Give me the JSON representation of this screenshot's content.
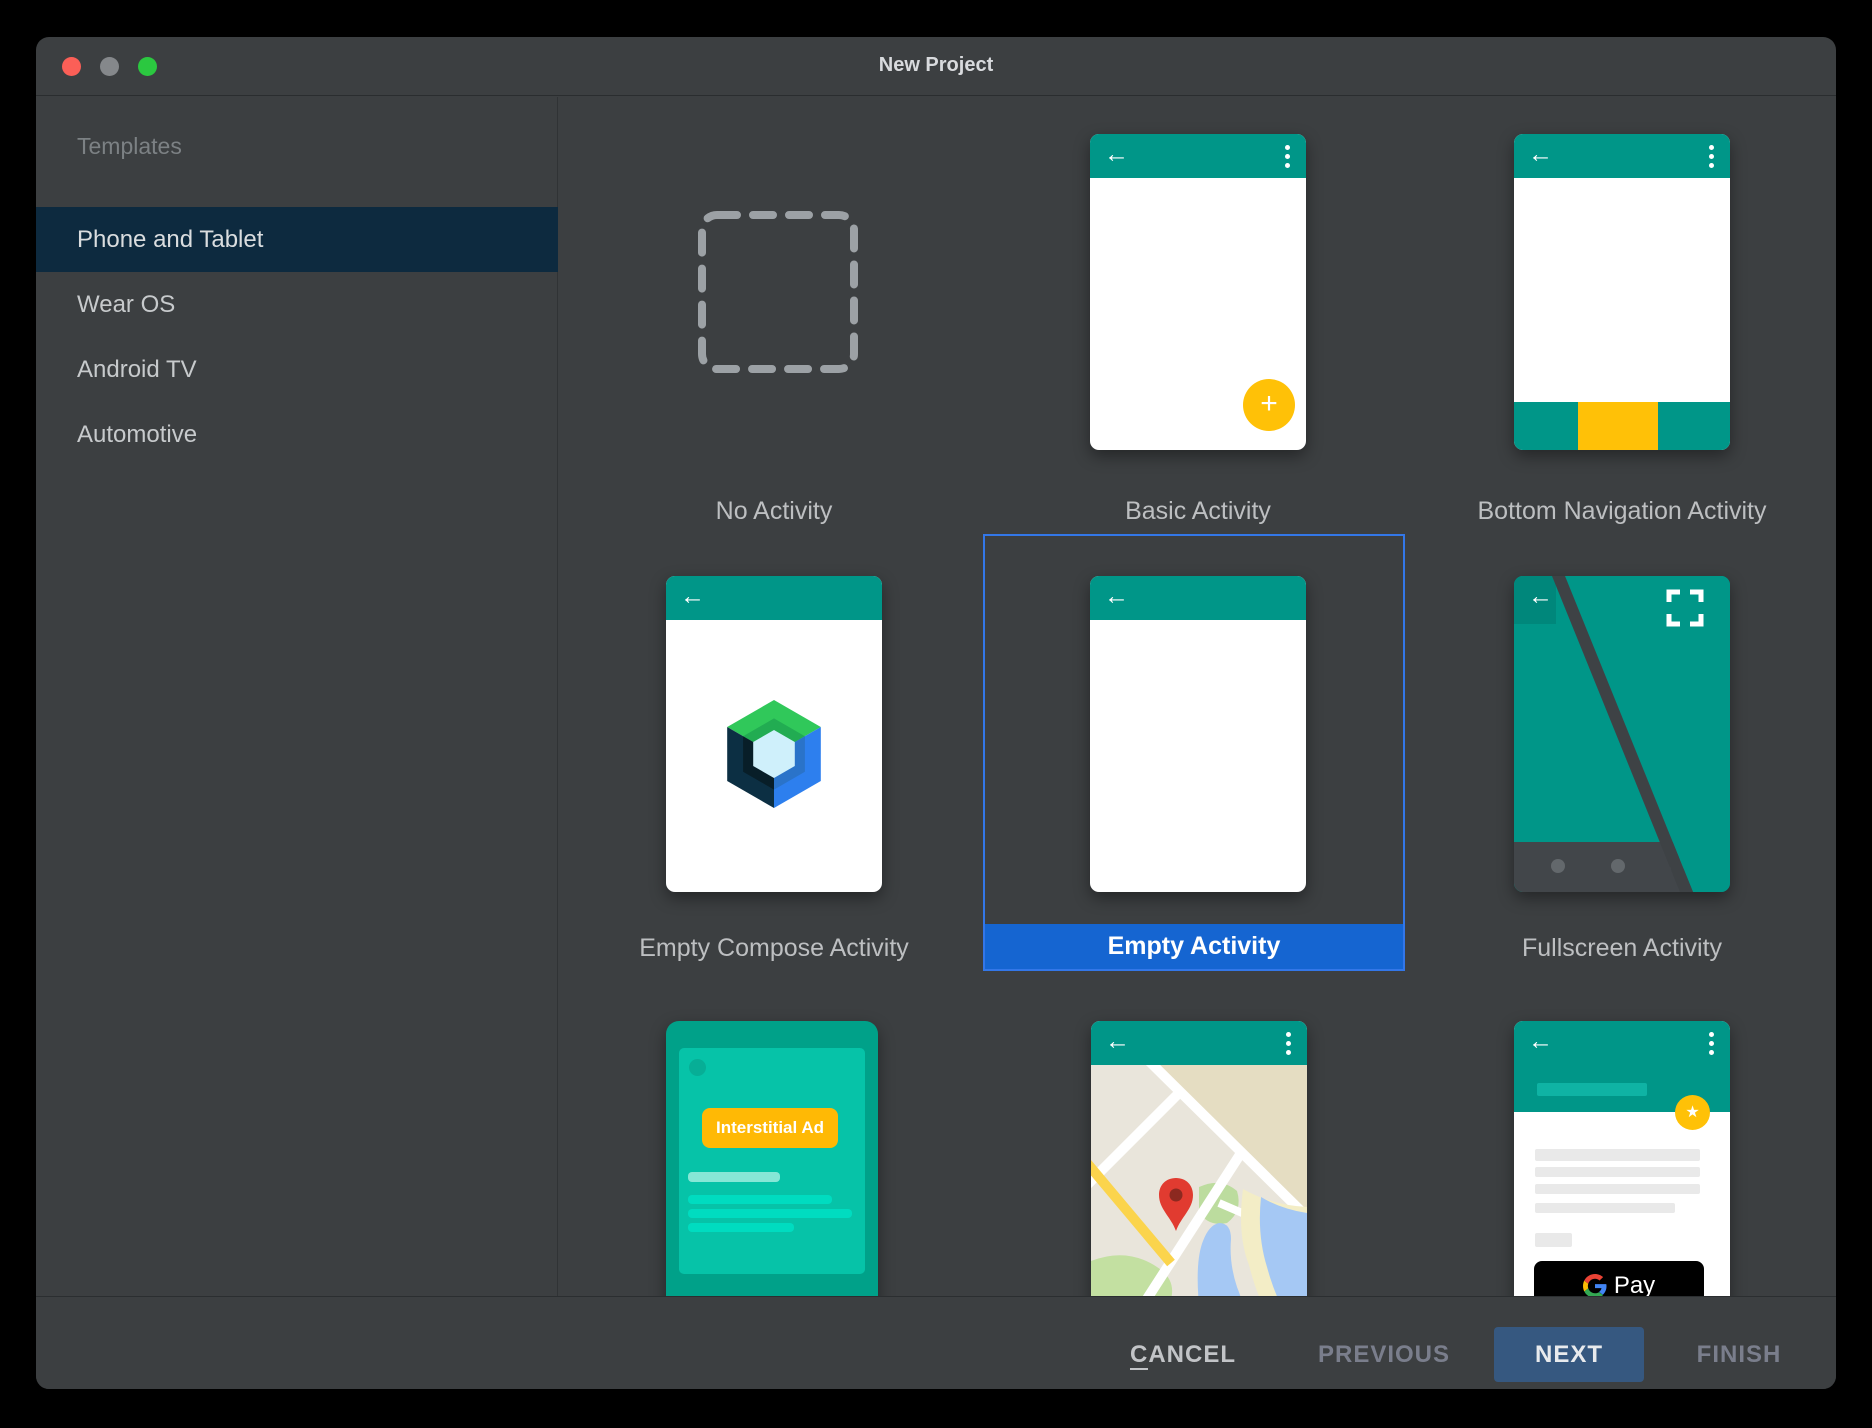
{
  "window": {
    "title": "New Project"
  },
  "sidebar": {
    "header": "Templates",
    "items": [
      {
        "label": "Phone and Tablet",
        "selected": true
      },
      {
        "label": "Wear OS",
        "selected": false
      },
      {
        "label": "Android TV",
        "selected": false
      },
      {
        "label": "Automotive",
        "selected": false
      }
    ]
  },
  "grid": {
    "tiles": [
      {
        "label": "No Activity",
        "selected": false
      },
      {
        "label": "Basic Activity",
        "selected": false
      },
      {
        "label": "Bottom Navigation Activity",
        "selected": false
      },
      {
        "label": "Empty Compose Activity",
        "selected": false
      },
      {
        "label": "Empty Activity",
        "selected": true
      },
      {
        "label": "Fullscreen Activity",
        "selected": false
      }
    ],
    "ad_card": {
      "chip": "Interstitial Ad"
    },
    "gpay_card": {
      "g": "G",
      "pay_label": "Pay"
    }
  },
  "footer": {
    "cancel_initial": "C",
    "cancel_rest": "ANCEL",
    "previous": "PREVIOUS",
    "next_initial": "N",
    "next_rest": "EXT",
    "finish": "FINISH"
  },
  "icons": {
    "back": "←",
    "plus": "+",
    "star": "★"
  },
  "colors": {
    "panel": "#3C3F41",
    "teal": "#009688",
    "amber": "#FFC107",
    "ad_chip_amber": "#FFB905",
    "selection_border": "#3377E8",
    "selection_label_bar": "#1565D1",
    "sidebar_selected": "#0D2A3F",
    "next_button": "#365880",
    "traffic_red": "#FB5F57",
    "traffic_gray": "#85888B",
    "traffic_green": "#2BC840"
  }
}
